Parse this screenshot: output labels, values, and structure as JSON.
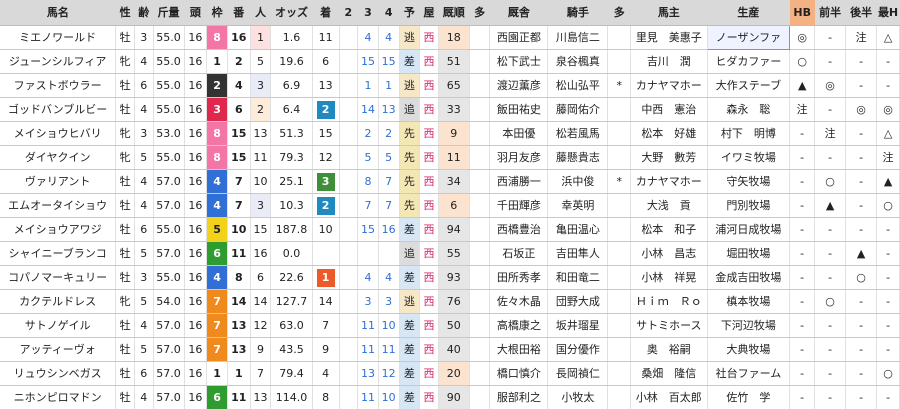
{
  "headers": [
    "馬名",
    "性",
    "齢",
    "斤量",
    "頭",
    "枠",
    "番",
    "人",
    "オッズ",
    "着",
    "2",
    "3",
    "4",
    "予",
    "屋",
    "厩順",
    "多",
    "厩舎",
    "騎手",
    "多",
    "馬主",
    "生産",
    "HB",
    "前半",
    "後半",
    "最H"
  ],
  "waku_colors": {
    "1": "#ffffff",
    "2": "#333333",
    "3": "#e0284f",
    "4": "#2f6fd6",
    "5": "#f2d21b",
    "6": "#2f9c2f",
    "7": "#f08a1c",
    "8": "#f476a6"
  },
  "rows": [
    {
      "name": "ミエノワールド",
      "sex": "牡",
      "age": "3",
      "kin": "55.0",
      "to": "16",
      "waku": "8",
      "ban": "16",
      "nin": "1",
      "odds": "1.6",
      "chaku": "11",
      "c2": "",
      "c3": "4",
      "c4": "4",
      "yo": "逃",
      "ya": "西",
      "kyu": "18",
      "ta": "",
      "stable": "西園正都",
      "jockey": "川島信二",
      "ta2": "",
      "owner": "里見　美惠子",
      "breeder": "ノーザンファ",
      "hb": "◎",
      "zen": "-",
      "kou": "注",
      "saih": "△"
    },
    {
      "name": "ジューンシルフィア",
      "sex": "牝",
      "age": "4",
      "kin": "55.0",
      "to": "16",
      "waku": "1",
      "ban": "2",
      "nin": "5",
      "odds": "19.6",
      "chaku": "6",
      "c2": "",
      "c3": "15",
      "c4": "15",
      "yo": "差",
      "ya": "西",
      "kyu": "51",
      "ta": "",
      "stable": "松下武士",
      "jockey": "泉谷楓真",
      "ta2": "",
      "owner": "吉川　潤",
      "breeder": "ヒダカファー",
      "hb": "○",
      "zen": "-",
      "kou": "-",
      "saih": "-"
    },
    {
      "name": "ファストボウラー",
      "sex": "牡",
      "age": "6",
      "kin": "55.0",
      "to": "16",
      "waku": "2",
      "ban": "4",
      "nin": "3",
      "odds": "6.9",
      "chaku": "13",
      "c2": "",
      "c3": "1",
      "c4": "1",
      "yo": "逃",
      "ya": "西",
      "kyu": "65",
      "ta": "",
      "stable": "渡辺薫彦",
      "jockey": "松山弘平",
      "ta2": "*",
      "owner": "カナヤマホー",
      "breeder": "大作ステーブ",
      "hb": "▲",
      "zen": "◎",
      "kou": "-",
      "saih": "-"
    },
    {
      "name": "ゴッドバンブルビー",
      "sex": "牡",
      "age": "4",
      "kin": "55.0",
      "to": "16",
      "waku": "3",
      "ban": "6",
      "nin": "2",
      "odds": "6.4",
      "chaku": "2",
      "c2": "",
      "c3": "14",
      "c4": "13",
      "yo": "追",
      "ya": "西",
      "kyu": "33",
      "ta": "",
      "stable": "飯田祐史",
      "jockey": "藤岡佑介",
      "ta2": "",
      "owner": "中西　憲治",
      "breeder": "森永　聡",
      "hb": "注",
      "zen": "-",
      "kou": "◎",
      "saih": "◎"
    },
    {
      "name": "メイショウヒバリ",
      "sex": "牝",
      "age": "3",
      "kin": "53.0",
      "to": "16",
      "waku": "8",
      "ban": "15",
      "nin": "13",
      "odds": "51.3",
      "chaku": "15",
      "c2": "",
      "c3": "2",
      "c4": "2",
      "yo": "先",
      "ya": "西",
      "kyu": "9",
      "ta": "",
      "stable": "本田優",
      "jockey": "松若風馬",
      "ta2": "",
      "owner": "松本　好雄",
      "breeder": "村下　明博",
      "hb": "-",
      "zen": "注",
      "kou": "-",
      "saih": "△"
    },
    {
      "name": "ダイヤクイン",
      "sex": "牝",
      "age": "5",
      "kin": "55.0",
      "to": "16",
      "waku": "8",
      "ban": "15",
      "nin": "11",
      "odds": "79.3",
      "chaku": "12",
      "c2": "",
      "c3": "5",
      "c4": "5",
      "yo": "先",
      "ya": "西",
      "kyu": "11",
      "ta": "",
      "stable": "羽月友彦",
      "jockey": "藤懸貴志",
      "ta2": "",
      "owner": "大野　數芳",
      "breeder": "イワミ牧場",
      "hb": "-",
      "zen": "-",
      "kou": "-",
      "saih": "注"
    },
    {
      "name": "ヴァリアント",
      "sex": "牡",
      "age": "4",
      "kin": "57.0",
      "to": "16",
      "waku": "4",
      "ban": "7",
      "nin": "10",
      "odds": "25.1",
      "chaku": "3",
      "c2": "",
      "c3": "8",
      "c4": "7",
      "yo": "先",
      "ya": "西",
      "kyu": "34",
      "ta": "",
      "stable": "西浦勝一",
      "jockey": "浜中俊",
      "ta2": "*",
      "owner": "カナヤマホー",
      "breeder": "守矢牧場",
      "hb": "-",
      "zen": "○",
      "kou": "-",
      "saih": "▲"
    },
    {
      "name": "エムオータイショウ",
      "sex": "牡",
      "age": "4",
      "kin": "57.0",
      "to": "16",
      "waku": "4",
      "ban": "7",
      "nin": "3",
      "odds": "10.3",
      "chaku": "2",
      "c2": "",
      "c3": "7",
      "c4": "7",
      "yo": "先",
      "ya": "西",
      "kyu": "6",
      "ta": "",
      "stable": "千田輝彦",
      "jockey": "幸英明",
      "ta2": "",
      "owner": "大浅　貢",
      "breeder": "門別牧場",
      "hb": "-",
      "zen": "▲",
      "kou": "-",
      "saih": "○"
    },
    {
      "name": "メイショウアワジ",
      "sex": "牡",
      "age": "6",
      "kin": "55.0",
      "to": "16",
      "waku": "5",
      "ban": "10",
      "nin": "15",
      "odds": "187.8",
      "chaku": "10",
      "c2": "",
      "c3": "15",
      "c4": "16",
      "yo": "差",
      "ya": "西",
      "kyu": "94",
      "ta": "",
      "stable": "西橋豊治",
      "jockey": "亀田温心",
      "ta2": "",
      "owner": "松本　和子",
      "breeder": "浦河日成牧場",
      "hb": "-",
      "zen": "-",
      "kou": "-",
      "saih": "-"
    },
    {
      "name": "シャイニーブランコ",
      "sex": "牡",
      "age": "5",
      "kin": "57.0",
      "to": "16",
      "waku": "6",
      "ban": "11",
      "nin": "16",
      "odds": "0.0",
      "chaku": "",
      "c2": "",
      "c3": "",
      "c4": "",
      "yo": "追",
      "ya": "西",
      "kyu": "55",
      "ta": "",
      "stable": "石坂正",
      "jockey": "吉田隼人",
      "ta2": "",
      "owner": "小林　昌志",
      "breeder": "堀田牧場",
      "hb": "-",
      "zen": "-",
      "kou": "▲",
      "saih": "-"
    },
    {
      "name": "コパノマーキュリー",
      "sex": "牡",
      "age": "3",
      "kin": "55.0",
      "to": "16",
      "waku": "4",
      "ban": "8",
      "nin": "6",
      "odds": "22.6",
      "chaku": "1",
      "c2": "",
      "c3": "4",
      "c4": "4",
      "yo": "差",
      "ya": "西",
      "kyu": "93",
      "ta": "",
      "stable": "田所秀孝",
      "jockey": "和田竜二",
      "ta2": "",
      "owner": "小林　祥晃",
      "breeder": "金成吉田牧場",
      "hb": "-",
      "zen": "-",
      "kou": "○",
      "saih": "-"
    },
    {
      "name": "カクテルドレス",
      "sex": "牝",
      "age": "5",
      "kin": "54.0",
      "to": "16",
      "waku": "7",
      "ban": "14",
      "nin": "14",
      "odds": "127.7",
      "chaku": "14",
      "c2": "",
      "c3": "3",
      "c4": "3",
      "yo": "逃",
      "ya": "西",
      "kyu": "76",
      "ta": "",
      "stable": "佐々木晶",
      "jockey": "団野大成",
      "ta2": "",
      "owner": "Ｈｉｍ　Ｒｏ",
      "breeder": "槙本牧場",
      "hb": "-",
      "zen": "○",
      "kou": "-",
      "saih": "-"
    },
    {
      "name": "サトノゲイル",
      "sex": "牡",
      "age": "4",
      "kin": "57.0",
      "to": "16",
      "waku": "7",
      "ban": "13",
      "nin": "12",
      "odds": "63.0",
      "chaku": "7",
      "c2": "",
      "c3": "11",
      "c4": "10",
      "yo": "差",
      "ya": "西",
      "kyu": "50",
      "ta": "",
      "stable": "高橋康之",
      "jockey": "坂井瑠星",
      "ta2": "",
      "owner": "サトミホース",
      "breeder": "下河辺牧場",
      "hb": "-",
      "zen": "-",
      "kou": "-",
      "saih": "-"
    },
    {
      "name": "アッティーヴォ",
      "sex": "牡",
      "age": "5",
      "kin": "57.0",
      "to": "16",
      "waku": "7",
      "ban": "13",
      "nin": "9",
      "odds": "43.5",
      "chaku": "9",
      "c2": "",
      "c3": "11",
      "c4": "11",
      "yo": "差",
      "ya": "西",
      "kyu": "40",
      "ta": "",
      "stable": "大根田裕",
      "jockey": "国分優作",
      "ta2": "",
      "owner": "奥　裕嗣",
      "breeder": "大典牧場",
      "hb": "-",
      "zen": "-",
      "kou": "-",
      "saih": "-"
    },
    {
      "name": "リュウシンベガス",
      "sex": "牡",
      "age": "6",
      "kin": "57.0",
      "to": "16",
      "waku": "1",
      "ban": "1",
      "nin": "7",
      "odds": "79.4",
      "chaku": "4",
      "c2": "",
      "c3": "13",
      "c4": "12",
      "yo": "差",
      "ya": "西",
      "kyu": "20",
      "ta": "",
      "stable": "橋口慎介",
      "jockey": "長岡禎仁",
      "ta2": "",
      "owner": "桑畑　隆信",
      "breeder": "社台ファーム",
      "hb": "-",
      "zen": "-",
      "kou": "-",
      "saih": "○"
    },
    {
      "name": "ニホンピロマドン",
      "sex": "牡",
      "age": "4",
      "kin": "57.0",
      "to": "16",
      "waku": "6",
      "ban": "11",
      "nin": "13",
      "odds": "114.0",
      "chaku": "8",
      "c2": "",
      "c3": "11",
      "c4": "10",
      "yo": "差",
      "ya": "西",
      "kyu": "90",
      "ta": "",
      "stable": "服部利之",
      "jockey": "小牧太",
      "ta2": "",
      "owner": "小林　百太郎",
      "breeder": "佐竹　学",
      "hb": "-",
      "zen": "-",
      "kou": "-",
      "saih": "-"
    }
  ]
}
